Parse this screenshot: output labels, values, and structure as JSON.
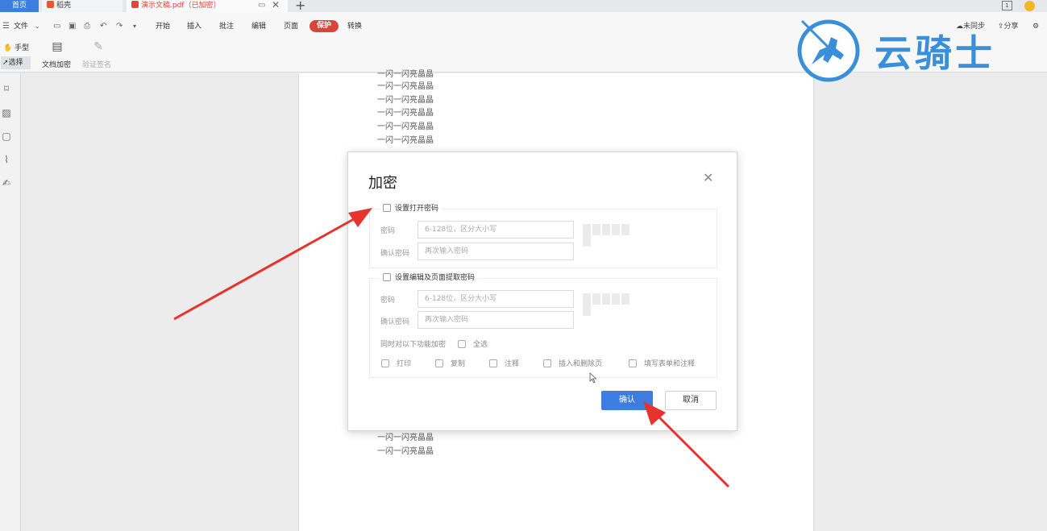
{
  "tabs": {
    "home": "首页",
    "daoke": "稻壳",
    "document": "演示文稿.pdf（已加密）"
  },
  "topbar_right": {
    "page_box": "1"
  },
  "menu": {
    "file": "文件",
    "items": [
      "开始",
      "插入",
      "批注",
      "编辑",
      "页面",
      "保护",
      "转换"
    ],
    "sync": "未同步",
    "share": "分享"
  },
  "ribbon": {
    "hand": "手型",
    "select": "选择",
    "doc_encrypt": "文档加密",
    "verify_sign": "验证签名"
  },
  "document": {
    "line_text": "一闪一闪亮晶晶"
  },
  "dialog": {
    "title": "加密",
    "open_group": {
      "checkbox": "设置打开密码",
      "password_label": "密码",
      "password_placeholder": "6-128位，区分大小写",
      "confirm_label": "确认密码",
      "confirm_placeholder": "再次输入密码"
    },
    "edit_group": {
      "checkbox": "设置编辑及页面提取密码",
      "password_label": "密码",
      "password_placeholder": "6-128位，区分大小写",
      "confirm_label": "确认密码",
      "confirm_placeholder": "再次输入密码",
      "also_encrypt": "同时对以下功能加密",
      "select_all": "全选",
      "options": [
        "打印",
        "复制",
        "注释",
        "插入和删除页",
        "填写表单和注释"
      ]
    },
    "confirm_button": "确认",
    "cancel_button": "取消"
  },
  "watermark": {
    "text": "云骑士"
  },
  "colors": {
    "accent_blue": "#3c7ee0",
    "protect_red": "#d7463b",
    "arrow_red": "#e8322e",
    "watermark_blue": "#3a8fd9"
  }
}
